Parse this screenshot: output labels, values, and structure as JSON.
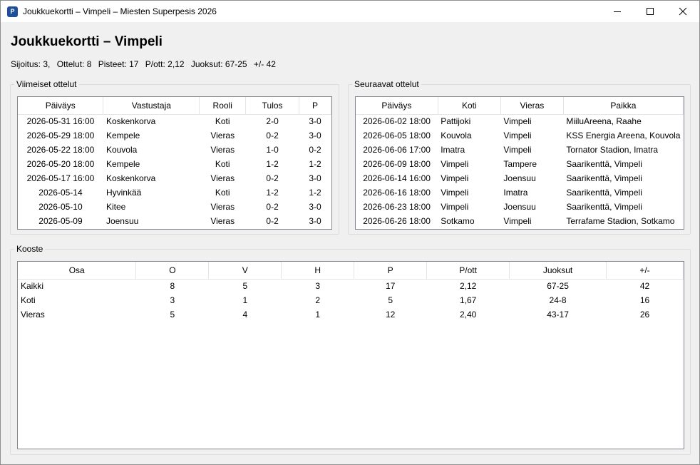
{
  "window": {
    "title": "Joukkuekortti – Vimpeli – Miesten Superpesis 2026",
    "icon_letter": "P",
    "icon": "app-icon"
  },
  "header": {
    "title": "Joukkuekortti – Vimpeli",
    "stats": [
      "Sijoitus: 3,",
      "Ottelut: 8",
      "Pisteet: 17",
      "P/ott: 2,12",
      "Juoksut: 67-25",
      "+/- 42"
    ]
  },
  "recent": {
    "label": "Viimeiset ottelut",
    "columns": [
      "Päiväys",
      "Vastustaja",
      "Rooli",
      "Tulos",
      "P"
    ],
    "rows": [
      [
        "2026-05-31 16:00",
        "Koskenkorva",
        "Koti",
        "2-0",
        "3-0"
      ],
      [
        "2026-05-29 18:00",
        "Kempele",
        "Vieras",
        "0-2",
        "3-0"
      ],
      [
        "2026-05-22 18:00",
        "Kouvola",
        "Vieras",
        "1-0",
        "0-2"
      ],
      [
        "2026-05-20 18:00",
        "Kempele",
        "Koti",
        "1-2",
        "1-2"
      ],
      [
        "2026-05-17 16:00",
        "Koskenkorva",
        "Vieras",
        "0-2",
        "3-0"
      ],
      [
        "2026-05-14",
        "Hyvinkää",
        "Koti",
        "1-2",
        "1-2"
      ],
      [
        "2026-05-10",
        "Kitee",
        "Vieras",
        "0-2",
        "3-0"
      ],
      [
        "2026-05-09",
        "Joensuu",
        "Vieras",
        "0-2",
        "3-0"
      ]
    ]
  },
  "upcoming": {
    "label": "Seuraavat ottelut",
    "columns": [
      "Päiväys",
      "Koti",
      "Vieras",
      "Paikka"
    ],
    "rows": [
      [
        "2026-06-02 18:00",
        "Pattijoki",
        "Vimpeli",
        "MiiluAreena, Raahe"
      ],
      [
        "2026-06-05 18:00",
        "Kouvola",
        "Vimpeli",
        "KSS Energia Areena, Kouvola"
      ],
      [
        "2026-06-06 17:00",
        "Imatra",
        "Vimpeli",
        "Tornator Stadion, Imatra"
      ],
      [
        "2026-06-09 18:00",
        "Vimpeli",
        "Tampere",
        "Saarikenttä, Vimpeli"
      ],
      [
        "2026-06-14 16:00",
        "Vimpeli",
        "Joensuu",
        "Saarikenttä, Vimpeli"
      ],
      [
        "2026-06-16 18:00",
        "Vimpeli",
        "Imatra",
        "Saarikenttä, Vimpeli"
      ],
      [
        "2026-06-23 18:00",
        "Vimpeli",
        "Joensuu",
        "Saarikenttä, Vimpeli"
      ],
      [
        "2026-06-26 18:00",
        "Sotkamo",
        "Vimpeli",
        "Terrafame Stadion, Sotkamo"
      ]
    ]
  },
  "summary": {
    "label": "Kooste",
    "columns": [
      "Osa",
      "O",
      "V",
      "H",
      "P",
      "P/ott",
      "Juoksut",
      "+/-"
    ],
    "rows": [
      [
        "Kaikki",
        "8",
        "5",
        "3",
        "17",
        "2,12",
        "67-25",
        "42"
      ],
      [
        "Koti",
        "3",
        "1",
        "2",
        "5",
        "1,67",
        "24-8",
        "16"
      ],
      [
        "Vieras",
        "5",
        "4",
        "1",
        "12",
        "2,40",
        "43-17",
        "26"
      ]
    ]
  }
}
